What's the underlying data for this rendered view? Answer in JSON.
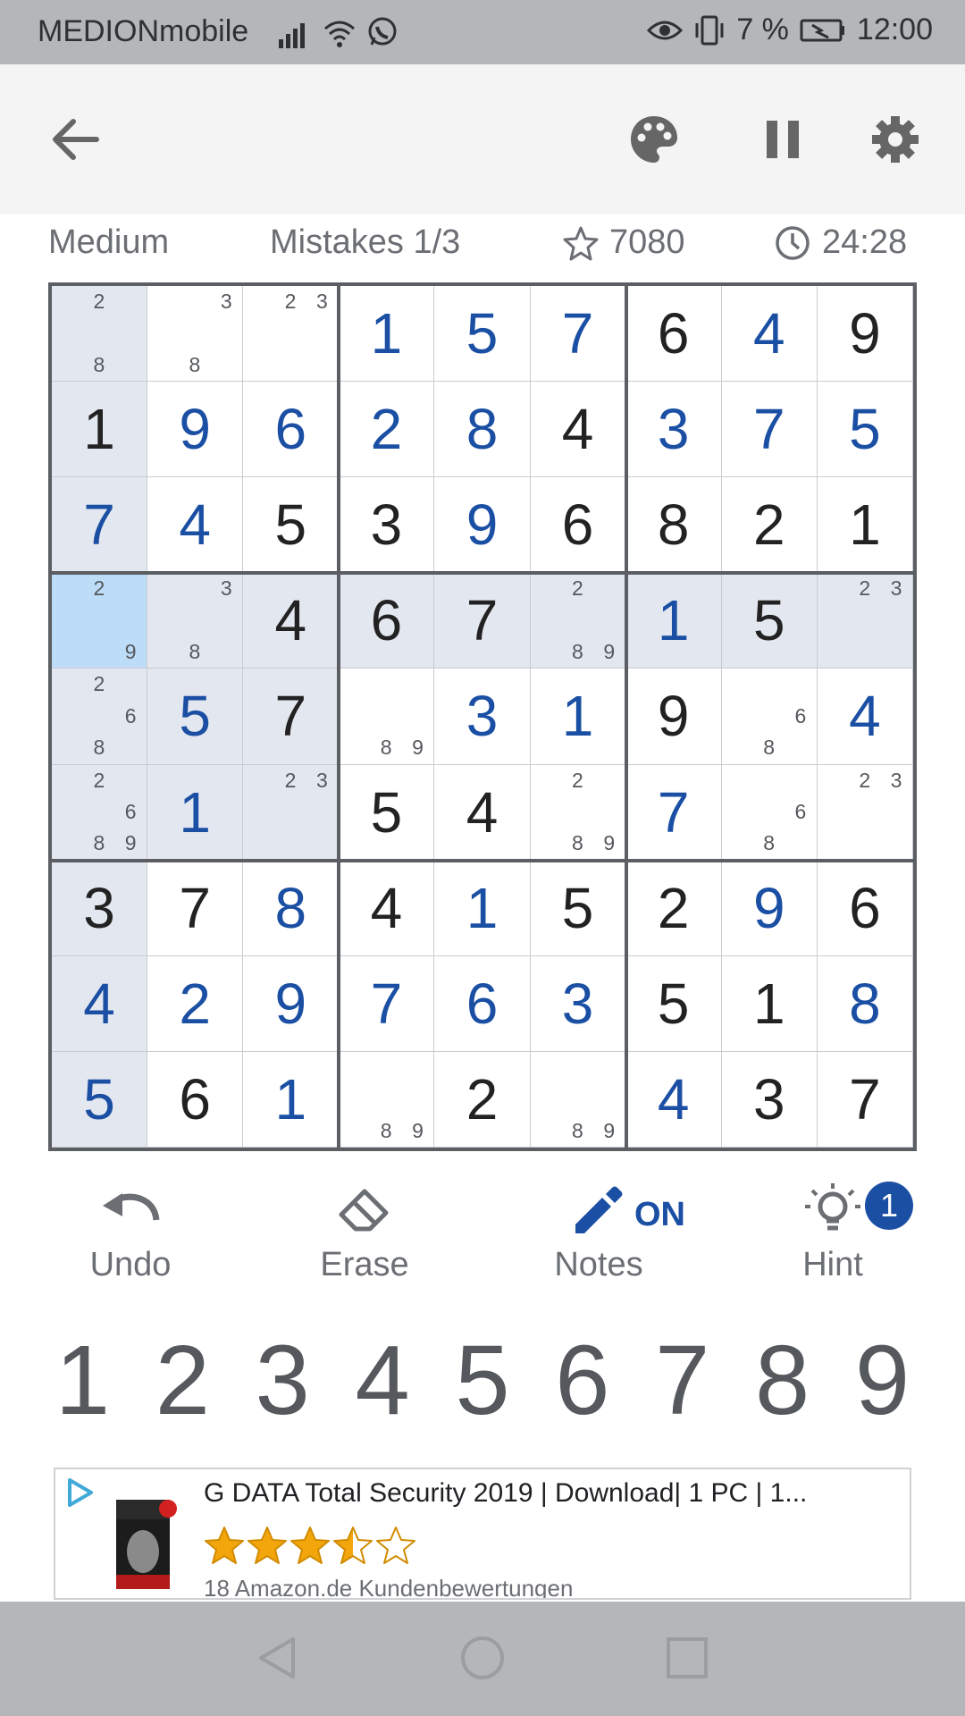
{
  "status_bar": {
    "carrier": "MEDIONmobile",
    "battery": "7 %",
    "time": "12:00"
  },
  "toolbar": {
    "back": "back",
    "theme": "palette",
    "pause": "pause",
    "settings": "settings"
  },
  "info": {
    "difficulty": "Medium",
    "mistakes": "Mistakes 1/3",
    "score": "7080",
    "timer": "24:28"
  },
  "board": {
    "cells": [
      [
        {
          "n": [
            2,
            8
          ]
        },
        {
          "n": [
            3,
            8
          ]
        },
        {
          "n": [
            2,
            3
          ]
        },
        {
          "v": 1,
          "c": "u"
        },
        {
          "v": 5,
          "c": "u"
        },
        {
          "v": 7,
          "c": "u"
        },
        {
          "v": 6,
          "c": "g"
        },
        {
          "v": 4,
          "c": "u"
        },
        {
          "v": 9,
          "c": "g"
        }
      ],
      [
        {
          "v": 1,
          "c": "g"
        },
        {
          "v": 9,
          "c": "u"
        },
        {
          "v": 6,
          "c": "u"
        },
        {
          "v": 2,
          "c": "u"
        },
        {
          "v": 8,
          "c": "u"
        },
        {
          "v": 4,
          "c": "g"
        },
        {
          "v": 3,
          "c": "u"
        },
        {
          "v": 7,
          "c": "u"
        },
        {
          "v": 5,
          "c": "u"
        }
      ],
      [
        {
          "v": 7,
          "c": "u"
        },
        {
          "v": 4,
          "c": "u"
        },
        {
          "v": 5,
          "c": "g"
        },
        {
          "v": 3,
          "c": "g"
        },
        {
          "v": 9,
          "c": "u"
        },
        {
          "v": 6,
          "c": "g"
        },
        {
          "v": 8,
          "c": "g"
        },
        {
          "v": 2,
          "c": "g"
        },
        {
          "v": 1,
          "c": "g"
        }
      ],
      [
        {
          "n": [
            2,
            9
          ]
        },
        {
          "n": [
            3,
            8
          ]
        },
        {
          "v": 4,
          "c": "g"
        },
        {
          "v": 6,
          "c": "g"
        },
        {
          "v": 7,
          "c": "g"
        },
        {
          "n": [
            2,
            8,
            9
          ]
        },
        {
          "v": 1,
          "c": "u"
        },
        {
          "v": 5,
          "c": "g"
        },
        {
          "n": [
            2,
            3
          ]
        }
      ],
      [
        {
          "n": [
            2,
            6,
            8
          ]
        },
        {
          "v": 5,
          "c": "u"
        },
        {
          "v": 7,
          "c": "g"
        },
        {
          "n": [
            8,
            9
          ]
        },
        {
          "v": 3,
          "c": "u"
        },
        {
          "v": 1,
          "c": "u"
        },
        {
          "v": 9,
          "c": "g"
        },
        {
          "n": [
            6,
            8
          ]
        },
        {
          "v": 4,
          "c": "u"
        }
      ],
      [
        {
          "n": [
            2,
            6,
            8,
            9
          ]
        },
        {
          "v": 1,
          "c": "u"
        },
        {
          "n": [
            2,
            3
          ]
        },
        {
          "v": 5,
          "c": "g"
        },
        {
          "v": 4,
          "c": "g"
        },
        {
          "n": [
            2,
            8,
            9
          ]
        },
        {
          "v": 7,
          "c": "u"
        },
        {
          "n": [
            6,
            8
          ]
        },
        {
          "n": [
            2,
            3
          ]
        }
      ],
      [
        {
          "v": 3,
          "c": "g"
        },
        {
          "v": 7,
          "c": "g"
        },
        {
          "v": 8,
          "c": "u"
        },
        {
          "v": 4,
          "c": "g"
        },
        {
          "v": 1,
          "c": "u"
        },
        {
          "v": 5,
          "c": "g"
        },
        {
          "v": 2,
          "c": "g"
        },
        {
          "v": 9,
          "c": "u"
        },
        {
          "v": 6,
          "c": "g"
        }
      ],
      [
        {
          "v": 4,
          "c": "u"
        },
        {
          "v": 2,
          "c": "u"
        },
        {
          "v": 9,
          "c": "u"
        },
        {
          "v": 7,
          "c": "u"
        },
        {
          "v": 6,
          "c": "u"
        },
        {
          "v": 3,
          "c": "u"
        },
        {
          "v": 5,
          "c": "g"
        },
        {
          "v": 1,
          "c": "g"
        },
        {
          "v": 8,
          "c": "u"
        }
      ],
      [
        {
          "v": 5,
          "c": "u"
        },
        {
          "v": 6,
          "c": "g"
        },
        {
          "v": 1,
          "c": "u"
        },
        {
          "n": [
            8,
            9
          ]
        },
        {
          "v": 2,
          "c": "g"
        },
        {
          "n": [
            8,
            9
          ]
        },
        {
          "v": 4,
          "c": "u"
        },
        {
          "v": 3,
          "c": "g"
        },
        {
          "v": 7,
          "c": "g"
        }
      ]
    ],
    "selected": [
      3,
      0
    ],
    "colors": {
      "given": "#222222",
      "user": "#1a4fa3",
      "highlight": "#e3e7ef",
      "selected": "#bcdcf7"
    }
  },
  "tools": {
    "undo": "Undo",
    "erase": "Erase",
    "notes": "Notes",
    "notes_state": "ON",
    "hint": "Hint",
    "hint_count": "1"
  },
  "numpad": [
    "1",
    "2",
    "3",
    "4",
    "5",
    "6",
    "7",
    "8",
    "9"
  ],
  "ad": {
    "title": "G DATA Total Security 2019 | Download| 1 PC | 1...",
    "rating": 3.5,
    "reviews": "18 Amazon.de Kundenbewertungen"
  }
}
